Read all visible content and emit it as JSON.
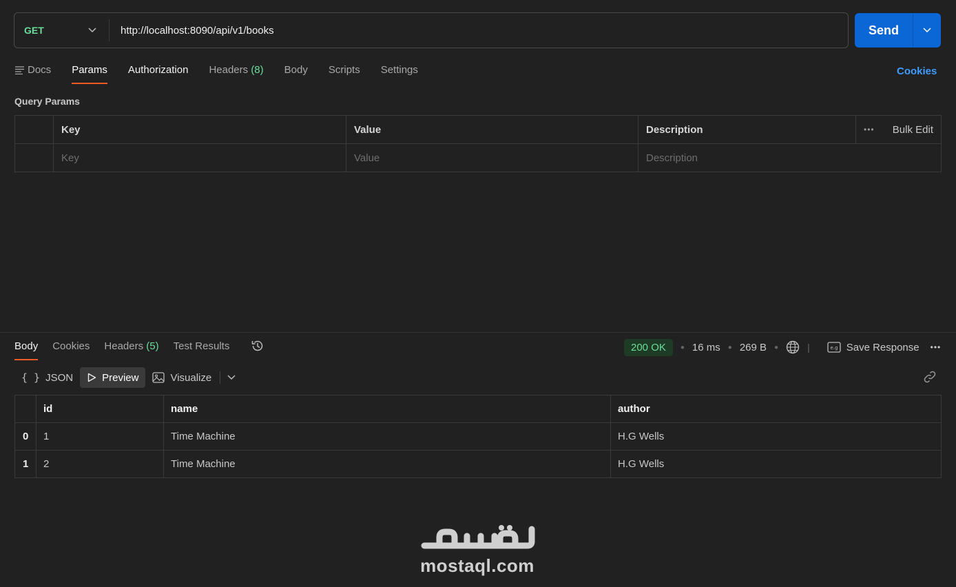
{
  "request": {
    "method": "GET",
    "url": "http://localhost:8090/api/v1/books",
    "send_label": "Send"
  },
  "request_tabs": {
    "docs": "Docs",
    "params": "Params",
    "authorization": "Authorization",
    "headers": "Headers",
    "headers_count": "(8)",
    "body": "Body",
    "scripts": "Scripts",
    "settings": "Settings",
    "cookies": "Cookies"
  },
  "query_params": {
    "title": "Query Params",
    "columns": [
      "Key",
      "Value",
      "Description"
    ],
    "bulk_edit": "Bulk Edit",
    "placeholders": [
      "Key",
      "Value",
      "Description"
    ]
  },
  "response_tabs": {
    "body": "Body",
    "cookies": "Cookies",
    "headers": "Headers",
    "headers_count": "(5)",
    "test_results": "Test Results"
  },
  "response_status": {
    "status": "200 OK",
    "time": "16 ms",
    "size": "269 B",
    "save_response": "Save Response"
  },
  "view_modes": {
    "json": "JSON",
    "preview": "Preview",
    "visualize": "Visualize"
  },
  "results": {
    "columns": [
      "id",
      "name",
      "author"
    ],
    "rows": [
      {
        "index": "0",
        "id": "1",
        "name": "Time Machine",
        "author": "H.G Wells"
      },
      {
        "index": "1",
        "id": "2",
        "name": "Time Machine",
        "author": "H.G Wells"
      }
    ]
  },
  "watermark": {
    "text": "mostaql.com",
    "logo_text": "مستقل"
  },
  "colors": {
    "accent_orange": "#ef5b25",
    "send_blue": "#0b67d6",
    "status_green": "#6bdd9a",
    "link_blue": "#3e9bff"
  }
}
